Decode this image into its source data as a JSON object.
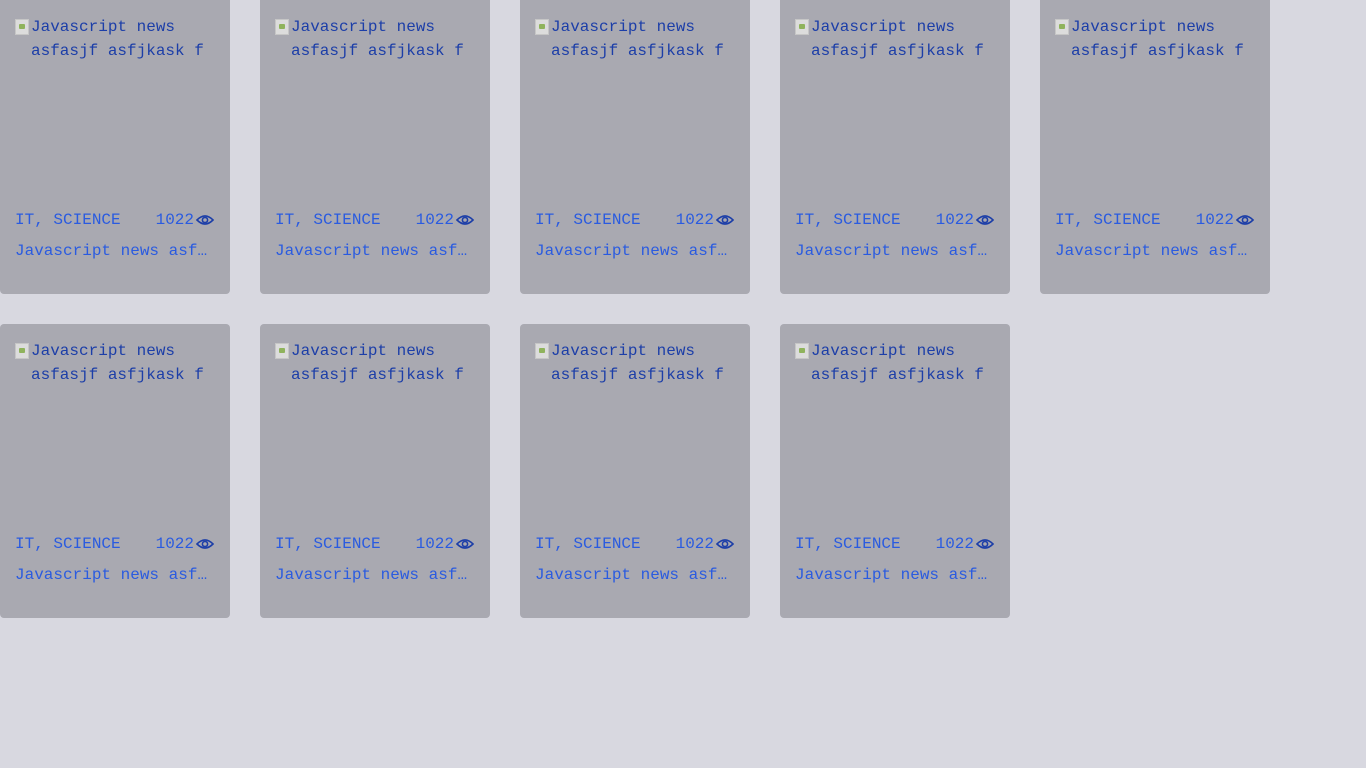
{
  "colors": {
    "background": "#d8d8e0",
    "card": "#a9a9b1",
    "link": "#2a5be0",
    "alt_text": "#1c3ea8"
  },
  "cards": [
    {
      "image_alt": "Javascript news asfasjf asfjkask f",
      "category": "IT, SCIENCE",
      "views": "1022",
      "title": "Javascript news asfasjf asfjkask f"
    },
    {
      "image_alt": "Javascript news asfasjf asfjkask f",
      "category": "IT, SCIENCE",
      "views": "1022",
      "title": "Javascript news asfasjf asfjkask f"
    },
    {
      "image_alt": "Javascript news asfasjf asfjkask f",
      "category": "IT, SCIENCE",
      "views": "1022",
      "title": "Javascript news asfasjf asfjkask f"
    },
    {
      "image_alt": "Javascript news asfasjf asfjkask f",
      "category": "IT, SCIENCE",
      "views": "1022",
      "title": "Javascript news asfasjf asfjkask f"
    },
    {
      "image_alt": "Javascript news asfasjf asfjkask f",
      "category": "IT, SCIENCE",
      "views": "1022",
      "title": "Javascript news asfasjf asfjkask f"
    },
    {
      "image_alt": "Javascript news asfasjf asfjkask f",
      "category": "IT, SCIENCE",
      "views": "1022",
      "title": "Javascript news asfasjf asfjkask f"
    },
    {
      "image_alt": "Javascript news asfasjf asfjkask f",
      "category": "IT, SCIENCE",
      "views": "1022",
      "title": "Javascript news asfasjf asfjkask f"
    },
    {
      "image_alt": "Javascript news asfasjf asfjkask f",
      "category": "IT, SCIENCE",
      "views": "1022",
      "title": "Javascript news asfasjf asfjkask f"
    },
    {
      "image_alt": "Javascript news asfasjf asfjkask f",
      "category": "IT, SCIENCE",
      "views": "1022",
      "title": "Javascript news asfasjf asfjkask f"
    }
  ],
  "icons": {
    "views": "eye-icon",
    "broken_image": "broken-image-icon"
  }
}
